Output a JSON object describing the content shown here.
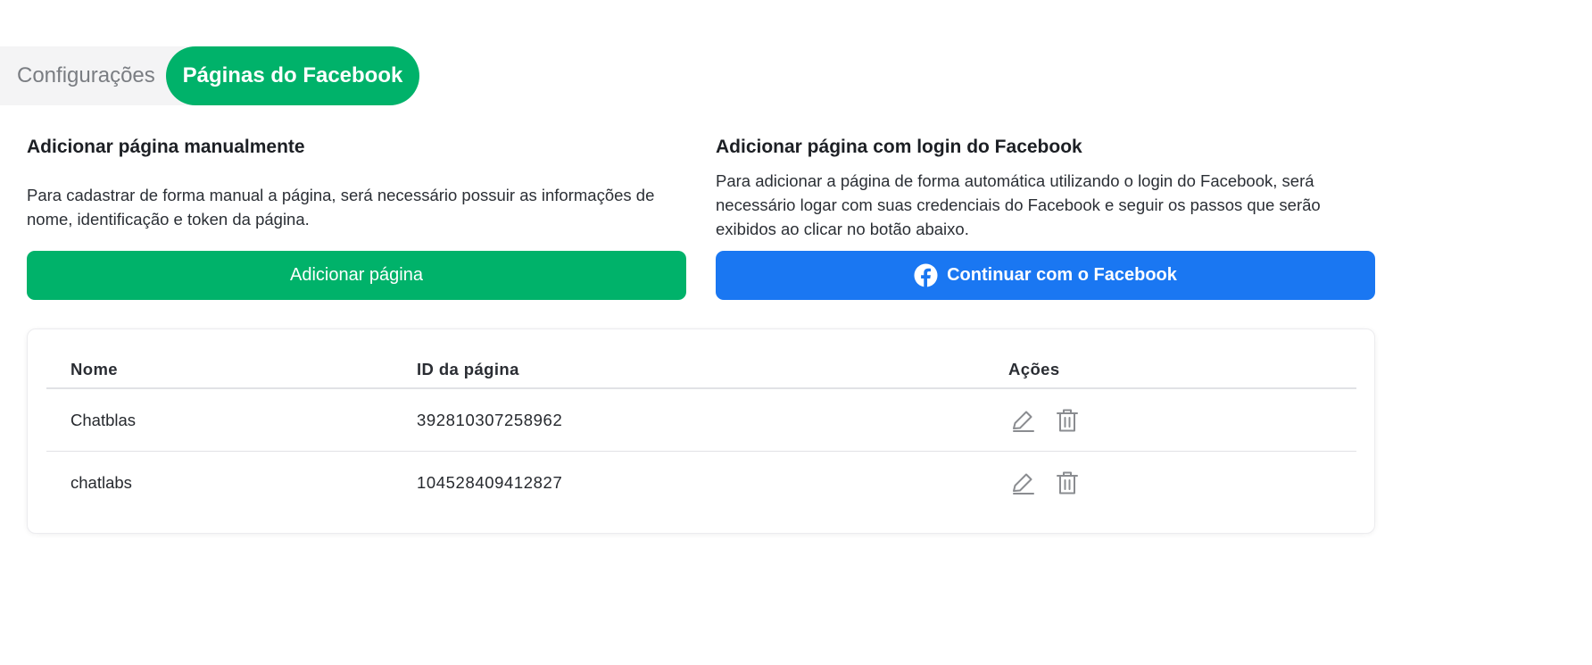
{
  "tabs": [
    {
      "label": "Configurações",
      "active": false
    },
    {
      "label": "Páginas do Facebook",
      "active": true
    }
  ],
  "manual": {
    "title": "Adicionar página manualmente",
    "description": "Para cadastrar de forma manual a página, será necessário possuir as informações de nome, identificação e token da página.",
    "button_label": "Adicionar página"
  },
  "facebook_login": {
    "title": "Adicionar página com login do Facebook",
    "description": "Para adicionar a página de forma automática utilizando o login do Facebook, será necessário logar com suas credenciais do Facebook e seguir os passos que serão exibidos ao clicar no botão abaixo.",
    "button_label": "Continuar com o Facebook",
    "button_icon": "facebook-icon"
  },
  "table": {
    "headers": {
      "name": "Nome",
      "page_id": "ID da página",
      "actions": "Ações"
    },
    "rows": [
      {
        "name": "Chatblas",
        "page_id": "392810307258962",
        "actions": [
          "edit-icon",
          "trash-icon"
        ]
      },
      {
        "name": "chatlabs",
        "page_id": "104528409412827",
        "actions": [
          "edit-icon",
          "trash-icon"
        ]
      }
    ]
  },
  "colors": {
    "accent_green": "#00b26a",
    "facebook_blue": "#1a77f2",
    "tab_inactive_bg": "#f4f4f5",
    "icon_gray": "#8a8c90"
  }
}
